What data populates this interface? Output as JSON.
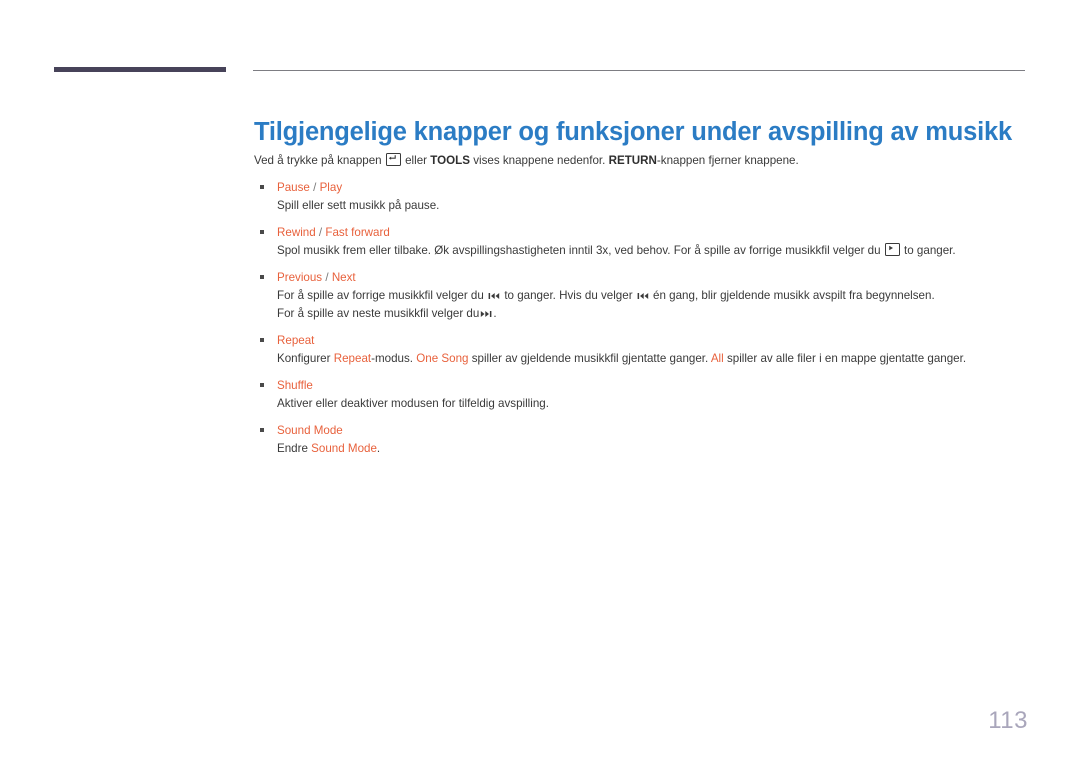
{
  "document": {
    "title": "Tilgjengelige knapper og funksjoner under avspilling av musikk",
    "page_number": "113"
  },
  "colors": {
    "title_blue": "#2b7cc4",
    "accent_orange": "#e8613c",
    "body_gray": "#3a3a3a",
    "header_bar_navy": "#474359",
    "header_rule_gray": "#7d7d83",
    "page_number_gray": "#a9a6bb"
  },
  "intro": {
    "part1": "Ved å trykke på knappen",
    "icon1": "enter-key-icon",
    "part2": "eller",
    "bold1": "TOOLS",
    "part3": "vises knappene nedenfor.",
    "bold2": "RETURN",
    "part4": "-knappen fjerner knappene."
  },
  "items": [
    {
      "label_a": "Pause",
      "separator": "/",
      "label_b": "Play",
      "lines": [
        {
          "text": "Spill eller sett musikk på pause."
        }
      ]
    },
    {
      "label_a": "Rewind",
      "separator": "/",
      "label_b": "Fast forward",
      "lines": [
        {
          "prefix": "Spol musikk frem eller tilbake. Øk avspillingshastigheten inntil 3x, ved behov. For å spille av forrige musikkfil velger du",
          "icon": "play-key-icon",
          "suffix": "to ganger."
        }
      ]
    },
    {
      "label_a": "Previous",
      "separator": "/",
      "label_b": "Next",
      "lines": [
        {
          "prefix": "For å spille av forrige musikkfil velger du",
          "icon": "previous-track-icon",
          "middle": "to ganger. Hvis du velger",
          "icon2": "previous-track-icon",
          "suffix": "én gang, blir gjeldende musikk avspilt fra begynnelsen."
        },
        {
          "prefix": "For å spille av neste musikkfil velger du",
          "icon": "next-track-icon",
          "suffix": "."
        }
      ]
    },
    {
      "label_a": "Repeat",
      "lines": [
        {
          "t1": "Konfigurer",
          "h1": "Repeat",
          "t2": "-modus.",
          "h2": "One Song",
          "t3": "spiller av gjeldende musikkfil gjentatte ganger.",
          "h3": "All",
          "t4": "spiller av alle filer i en mappe gjentatte ganger."
        }
      ]
    },
    {
      "label_a": "Shuffle",
      "lines": [
        {
          "text": "Aktiver eller deaktiver modusen for tilfeldig avspilling."
        }
      ]
    },
    {
      "label_a": "Sound Mode",
      "lines": [
        {
          "t1": "Endre",
          "h1": "Sound Mode",
          "t2": "."
        }
      ]
    }
  ]
}
